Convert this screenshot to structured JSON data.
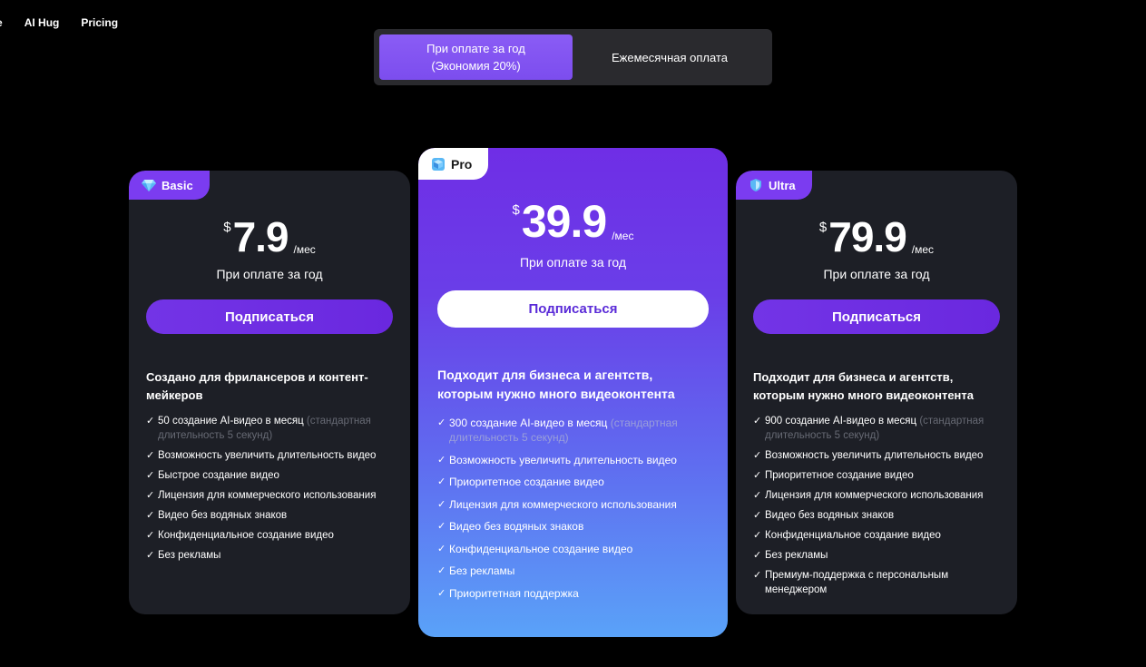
{
  "nav": {
    "cut_label": "e",
    "items": [
      "AI Hug",
      "Pricing"
    ]
  },
  "billing": {
    "yearly_label": "При оплате за год\n(Экономия 20%)",
    "monthly_label": "Ежемесячная оплата",
    "active": "yearly"
  },
  "colors": {
    "accent_purple": "#7b3cf0",
    "pro_gradient_top": "#6f2ee6",
    "pro_gradient_bottom": "#5aa2f8",
    "side_card_bg": "#1d1f26"
  },
  "plans": {
    "basic": {
      "badge": "Basic",
      "badge_icon": "diamond-icon",
      "currency": "$",
      "price": "7.9",
      "per": "/мес",
      "billing_note": "При оплате за год",
      "cta": "Подписаться",
      "description": "Создано для фрилансеров и контент-мейкеров",
      "features": [
        {
          "text": "50 создание AI-видео в месяц ",
          "note": "(стандартная длительность 5 секунд)"
        },
        {
          "text": "Возможность увеличить длительность видео"
        },
        {
          "text": "Быстрое создание видео"
        },
        {
          "text": "Лицензия для коммерческого использования"
        },
        {
          "text": "Видео без водяных знаков"
        },
        {
          "text": "Конфиденциальное создание видео"
        },
        {
          "text": "Без рекламы"
        }
      ]
    },
    "pro": {
      "badge": "Pro",
      "badge_icon": "cube-icon",
      "currency": "$",
      "price": "39.9",
      "per": "/мес",
      "billing_note": "При оплате за год",
      "cta": "Подписаться",
      "description": "Подходит для бизнеса и агентств, которым нужно много видеоконтента",
      "features": [
        {
          "text": "300 создание AI-видео в месяц ",
          "note": "(стандартная длительность 5 секунд)"
        },
        {
          "text": "Возможность увеличить длительность видео"
        },
        {
          "text": "Приоритетное создание видео"
        },
        {
          "text": "Лицензия для коммерческого использования"
        },
        {
          "text": "Видео без водяных знаков"
        },
        {
          "text": "Конфиденциальное создание видео"
        },
        {
          "text": "Без рекламы"
        },
        {
          "text": "Приоритетная поддержка"
        }
      ]
    },
    "ultra": {
      "badge": "Ultra",
      "badge_icon": "shield-icon",
      "currency": "$",
      "price": "79.9",
      "per": "/мес",
      "billing_note": "При оплате за год",
      "cta": "Подписаться",
      "description": "Подходит для бизнеса и агентств, которым нужно много видеоконтента",
      "features": [
        {
          "text": "900 создание AI-видео в месяц ",
          "note": "(стандартная длительность 5 секунд)"
        },
        {
          "text": "Возможность увеличить длительность видео"
        },
        {
          "text": "Приоритетное создание видео"
        },
        {
          "text": "Лицензия для коммерческого использования"
        },
        {
          "text": "Видео без водяных знаков"
        },
        {
          "text": "Конфиденциальное создание видео"
        },
        {
          "text": "Без рекламы"
        },
        {
          "text": "Премиум-поддержка с персональным менеджером"
        }
      ]
    }
  }
}
